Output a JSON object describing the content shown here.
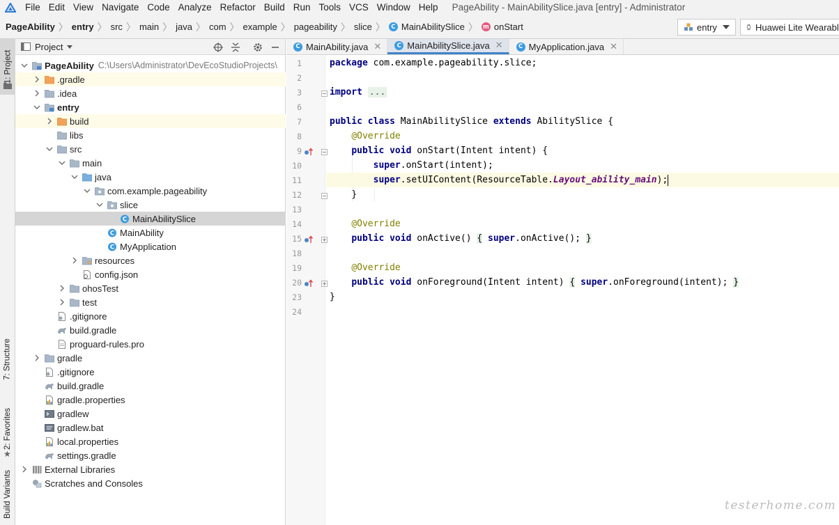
{
  "menubar": {
    "items": [
      "File",
      "Edit",
      "View",
      "Navigate",
      "Code",
      "Analyze",
      "Refactor",
      "Build",
      "Run",
      "Tools",
      "VCS",
      "Window",
      "Help"
    ],
    "window_title": "PageAbility - MainAbilitySlice.java [entry] - Administrator"
  },
  "navbar": {
    "crumbs": [
      "PageAbility",
      "entry",
      "src",
      "main",
      "java",
      "com",
      "example",
      "pageability",
      "slice",
      "MainAbilitySlice",
      "onStart"
    ],
    "run_config": "entry",
    "device": "Huawei Lite Wearable"
  },
  "tool_stripe": {
    "project": "1: Project",
    "structure": "7: Structure",
    "favorites": "2: Favorites",
    "build_variants": "Build Variants"
  },
  "project_panel": {
    "title": "Project",
    "rows": [
      {
        "label": "PageAbility",
        "path": "C:\\Users\\Administrator\\DevEcoStudioProjects\\"
      },
      {
        "label": ".gradle"
      },
      {
        "label": ".idea"
      },
      {
        "label": "entry"
      },
      {
        "label": "build"
      },
      {
        "label": "libs"
      },
      {
        "label": "src"
      },
      {
        "label": "main"
      },
      {
        "label": "java"
      },
      {
        "label": "com.example.pageability"
      },
      {
        "label": "slice"
      },
      {
        "label": "MainAbilitySlice"
      },
      {
        "label": "MainAbility"
      },
      {
        "label": "MyApplication"
      },
      {
        "label": "resources"
      },
      {
        "label": "config.json"
      },
      {
        "label": "ohosTest"
      },
      {
        "label": "test"
      },
      {
        "label": ".gitignore"
      },
      {
        "label": "build.gradle"
      },
      {
        "label": "proguard-rules.pro"
      },
      {
        "label": "gradle"
      },
      {
        "label": ".gitignore"
      },
      {
        "label": "build.gradle"
      },
      {
        "label": "gradle.properties"
      },
      {
        "label": "gradlew"
      },
      {
        "label": "gradlew.bat"
      },
      {
        "label": "local.properties"
      },
      {
        "label": "settings.gradle"
      },
      {
        "label": "External Libraries"
      },
      {
        "label": "Scratches and Consoles"
      }
    ]
  },
  "editor": {
    "tabs": [
      "MainAbility.java",
      "MainAbilitySlice.java",
      "MyApplication.java"
    ],
    "line_numbers": [
      "1",
      "2",
      "3",
      "6",
      "7",
      "8",
      "9",
      "10",
      "11",
      "12",
      "13",
      "14",
      "15",
      "18",
      "19",
      "20",
      "23",
      "24"
    ],
    "code": {
      "l1_kw": "package",
      "l1_rest": " com.example.pageability.slice;",
      "l3_kw": "import",
      "l3_fold": "...",
      "l7_kw1": "public",
      "l7_kw2": "class",
      "l7_name": " MainAbilitySlice ",
      "l7_kw3": "extends",
      "l7_rest": " AbilitySlice {",
      "l8_ann": "@Override",
      "l9_kw1": "public",
      "l9_kw2": "void",
      "l9_rest": " onStart(Intent intent) {",
      "l10_kw": "super",
      "l10_rest": ".onStart(intent);",
      "l11_kw": "super",
      "l11_pre": ".setUIContent(ResourceTable.",
      "l11_it": "Layout_ability_main",
      "l11_post": ");",
      "l12": "}",
      "l14_ann": "@Override",
      "l15_kw1": "public",
      "l15_kw2": "void",
      "l15_rest": " onActive() ",
      "l15_open": "{",
      "l15_kw3": "super",
      "l15_call": ".onActive(); ",
      "l15_close": "}",
      "l19_ann": "@Override",
      "l20_kw1": "public",
      "l20_kw2": "void",
      "l20_rest": " onForeground(Intent intent) ",
      "l20_open": "{",
      "l20_kw3": "super",
      "l20_call": ".onForeground(intent); ",
      "l20_close": "}",
      "l23": "}"
    }
  },
  "watermark": "testerhome.com"
}
